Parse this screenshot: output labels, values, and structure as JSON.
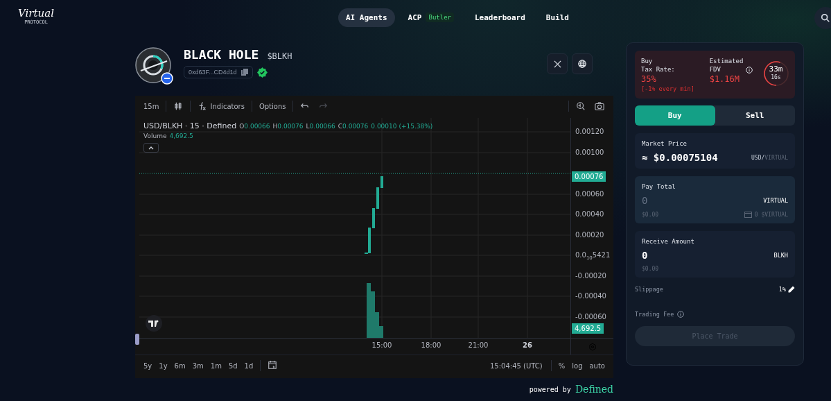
{
  "logo": {
    "script": "Virtual",
    "sub": "PROTOCOL"
  },
  "nav": [
    {
      "label": "AI Agents",
      "selected": true
    },
    {
      "label": "ACP",
      "selected": false,
      "badge": "Butler"
    },
    {
      "label": "Leaderboard",
      "selected": false
    },
    {
      "label": "Build",
      "selected": false
    }
  ],
  "token": {
    "name": "BLACK HOLE",
    "ticker": "$BLKH",
    "address": "0xd63F...CD4d1d",
    "verified": true
  },
  "chart": {
    "toolbar": {
      "interval": "15m",
      "indicators": "Indicators",
      "options": "Options"
    },
    "legend": {
      "symbol": "USD/BLKH · 15 · Defined",
      "ohlc": [
        {
          "key": "O",
          "value": "0.00066"
        },
        {
          "key": "H",
          "value": "0.00076"
        },
        {
          "key": "L",
          "value": "0.00066"
        },
        {
          "key": "C",
          "value": "0.00076"
        }
      ],
      "change": "0.00010 (+15.38%)"
    },
    "volume": {
      "label": "Volume",
      "value": "4,692.5"
    },
    "price_axis": [
      {
        "label": "0.00120",
        "kind": "tick"
      },
      {
        "label": "0.00100",
        "kind": "tick"
      },
      {
        "label": "0.00076",
        "kind": "badge"
      },
      {
        "label": "0.00060",
        "kind": "tick"
      },
      {
        "label": "0.00040",
        "kind": "tick"
      },
      {
        "label": "0.00020",
        "kind": "tick"
      },
      {
        "label": "0.0$_{10}$5421",
        "kind": "tick"
      },
      {
        "label": "-0.00020",
        "kind": "tick"
      },
      {
        "label": "-0.00040",
        "kind": "tick"
      },
      {
        "label": "-0.00060",
        "kind": "tick"
      },
      {
        "label": "4,692.5",
        "kind": "badge"
      }
    ],
    "time_axis": [
      {
        "label": "15:00",
        "bold": false
      },
      {
        "label": "18:00",
        "bold": false
      },
      {
        "label": "21:00",
        "bold": false
      },
      {
        "label": "26",
        "bold": true
      }
    ],
    "ranges": [
      "5y",
      "1y",
      "6m",
      "3m",
      "1m",
      "5d",
      "1d"
    ],
    "clock": "15:04:45 (UTC)",
    "scale_options": [
      "%",
      "log",
      "auto"
    ]
  },
  "powered_by": {
    "text": "powered by",
    "brand": "Defined"
  },
  "trade": {
    "tax": {
      "label": "Buy\nTax Rate:",
      "value": "35%",
      "note": "[-1% every min]",
      "fdv_label": "Estimated\nFDV",
      "fdv_value": "$1.16M",
      "timer_minutes": "33m",
      "timer_seconds": "16s"
    },
    "tabs": [
      {
        "label": "Buy",
        "selected": true
      },
      {
        "label": "Sell",
        "selected": false
      }
    ],
    "market": {
      "label": "Market Price",
      "value": "≈ $0.00075104",
      "unit": "USD/",
      "unit_dim": "VIRTUAL"
    },
    "pay": {
      "label": "Pay Total",
      "placeholder": "0",
      "currency": "VIRTUAL",
      "usd": "$0.00",
      "balance": "0 $VIRTUAL"
    },
    "receive": {
      "label": "Receive Amount",
      "value": "0",
      "currency": "BLKH",
      "usd": "$0.00"
    },
    "slippage": {
      "label": "Slippage",
      "value": "1%"
    },
    "fee": {
      "label": "Trading Fee"
    },
    "submit": {
      "label": "Place Trade",
      "disabled": true
    }
  }
}
